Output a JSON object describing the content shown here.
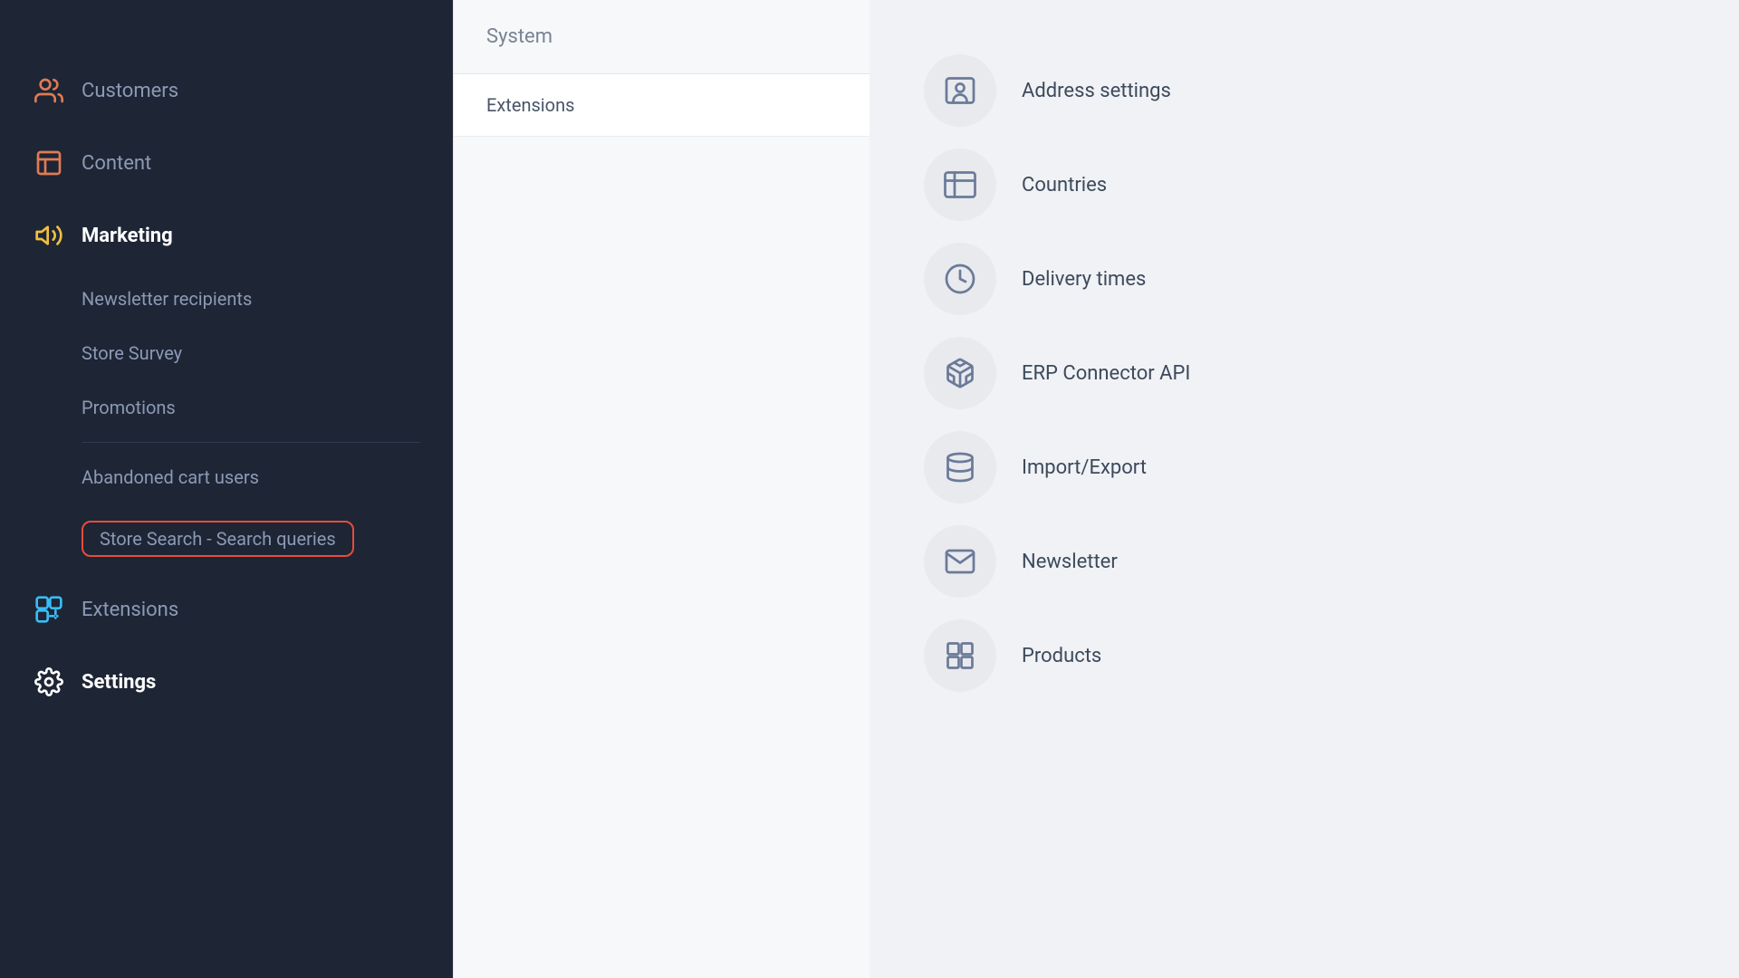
{
  "sidebar": {
    "items": [
      {
        "label": "Customers",
        "icon": "customers",
        "active": false
      },
      {
        "label": "Content",
        "icon": "content",
        "active": false
      },
      {
        "label": "Marketing",
        "icon": "marketing",
        "active": true
      },
      {
        "label": "Extensions",
        "icon": "extensions",
        "active": false
      },
      {
        "label": "Settings",
        "icon": "settings",
        "active": true
      }
    ],
    "marketing_subitems": [
      {
        "label": "Newsletter recipients",
        "highlighted": false
      },
      {
        "label": "Store Survey",
        "highlighted": false
      },
      {
        "label": "Promotions",
        "highlighted": false
      },
      {
        "label": "Abandoned cart users",
        "highlighted": false
      },
      {
        "label": "Store Search - Search queries",
        "highlighted": true
      }
    ]
  },
  "middle": {
    "header": "System",
    "items": [
      {
        "label": "Extensions"
      }
    ]
  },
  "settings_items": [
    {
      "label": "Address settings",
      "icon": "address"
    },
    {
      "label": "Countries",
      "icon": "countries"
    },
    {
      "label": "Delivery times",
      "icon": "delivery"
    },
    {
      "label": "ERP Connector API",
      "icon": "erp"
    },
    {
      "label": "Import/Export",
      "icon": "importexport"
    },
    {
      "label": "Newsletter",
      "icon": "newsletter"
    },
    {
      "label": "Products",
      "icon": "products"
    }
  ]
}
